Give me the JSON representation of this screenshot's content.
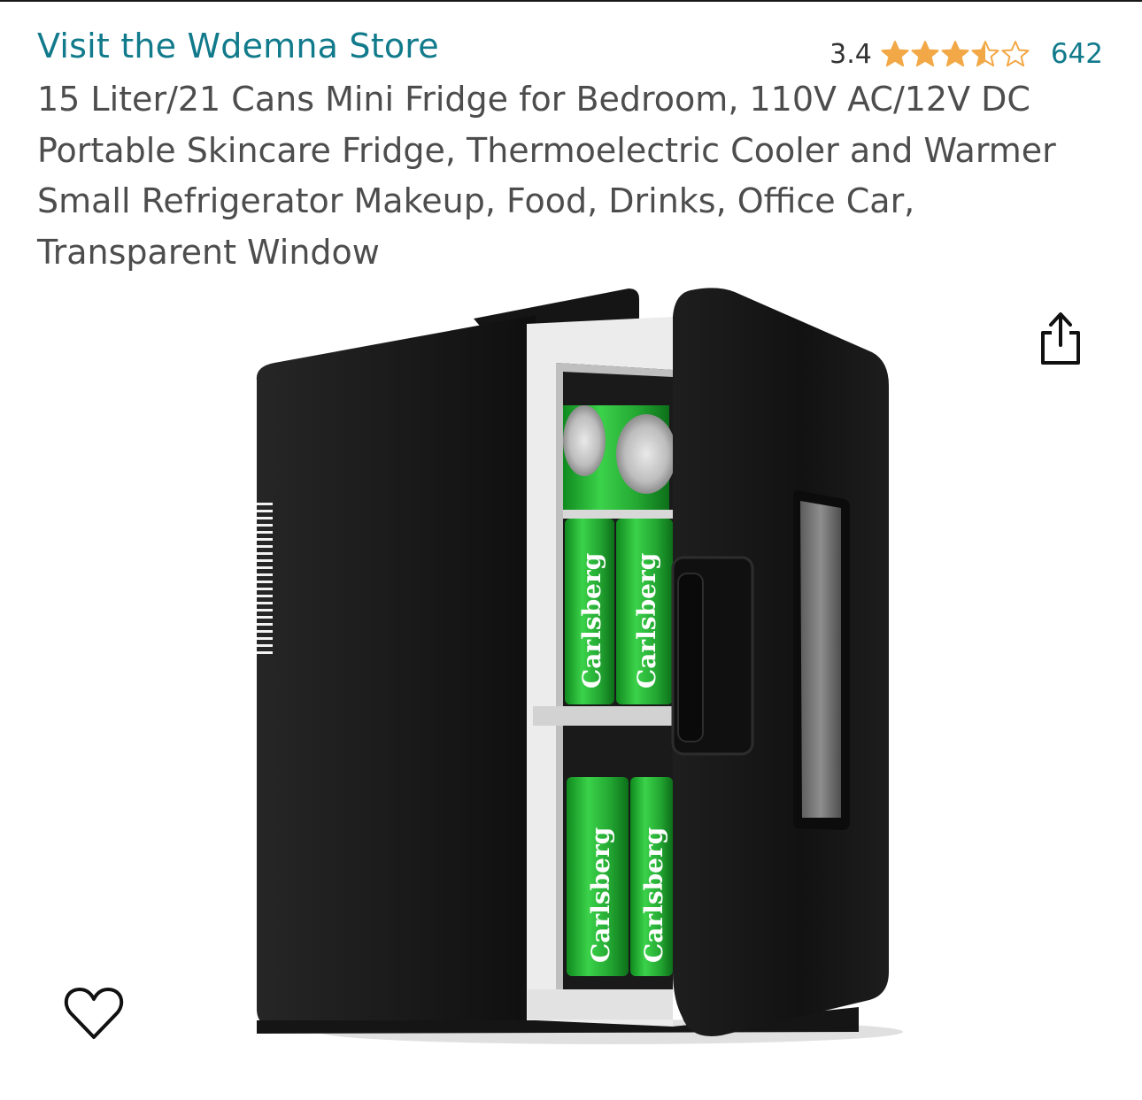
{
  "store": {
    "link_text": "Visit the Wdemna Store"
  },
  "rating": {
    "value": "3.4",
    "stars_filled": 3.4,
    "stars_max": 5,
    "count": "642",
    "star_color": "#f3a847"
  },
  "product": {
    "title": "15 Liter/21 Cans Mini Fridge for Bedroom, 110V AC/12V DC Portable Skincare Fridge, Thermoelectric Cooler and Warmer Small Refrigerator Makeup, Food, Drinks, Office Car, Transparent Window",
    "can_label": "Carlsberg"
  },
  "icons": {
    "share": "share-icon",
    "wishlist": "heart-icon"
  },
  "colors": {
    "link": "#117a8b",
    "title": "#4d4d4d",
    "can_green": "#2fbf3a"
  }
}
